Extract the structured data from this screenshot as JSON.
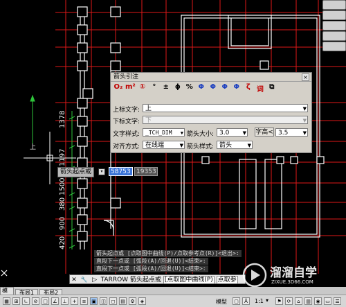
{
  "colors": {
    "canvas_bg": "#000000",
    "grid_red": "#e01818",
    "wall_white": "#ffffff",
    "dim_green": "#2ec43a",
    "accent_blue": "#3a74d8"
  },
  "dimensions": {
    "labels": [
      "1378",
      "1197",
      "1500",
      "380",
      "900",
      "420"
    ]
  },
  "ucs_label": "上",
  "dialog": {
    "title": "箭头引注",
    "close_label": "×",
    "symbols": [
      "O₂",
      "m²",
      "①",
      "°",
      "±",
      "ϕ",
      "%",
      "Φ",
      "Φ",
      "Φ",
      "Φ",
      "ζ",
      "词",
      "⧉"
    ],
    "upper_label": "上标文字:",
    "upper_value": "上",
    "lower_label": "下标文字:",
    "lower_value": "下",
    "style_label": "文字样式:",
    "style_value": "_TCH_DIM",
    "arrow_size_label": "箭头大小:",
    "arrow_size_value": "3.0",
    "char_height_button": "字高<",
    "char_height_value": "3.5",
    "align_label": "对齐方式:",
    "align_value": "在线端",
    "arrow_style_label": "箭头样式:",
    "arrow_style_value": "箭头"
  },
  "dynamic_input": {
    "prompt": "箭头起点或",
    "x_value": "58753",
    "y_value": "19353"
  },
  "history": [
    "箭头起点或 [点取图中曲线(P)/点取参考点(R)]<退出>:",
    "直段下一点或 [弧段(A)/回退(U)]<结束>:",
    "直段下一点或 [弧段(A)/回退(U)]<结束>:"
  ],
  "command": {
    "close": "✕",
    "wrench": "🔧",
    "prompt_icon": "▷",
    "text": "TARROW 箭头起点或",
    "option1": "[点取图中曲线(P)",
    "option2": "点取参"
  },
  "tabs": [
    "模型",
    "布局1",
    "布局2"
  ],
  "status": {
    "model": "模型",
    "scale": "1:1",
    "arrow": "▾"
  },
  "brand": {
    "name": "溜溜自学",
    "url": "ZIXUE.3D66.COM"
  }
}
